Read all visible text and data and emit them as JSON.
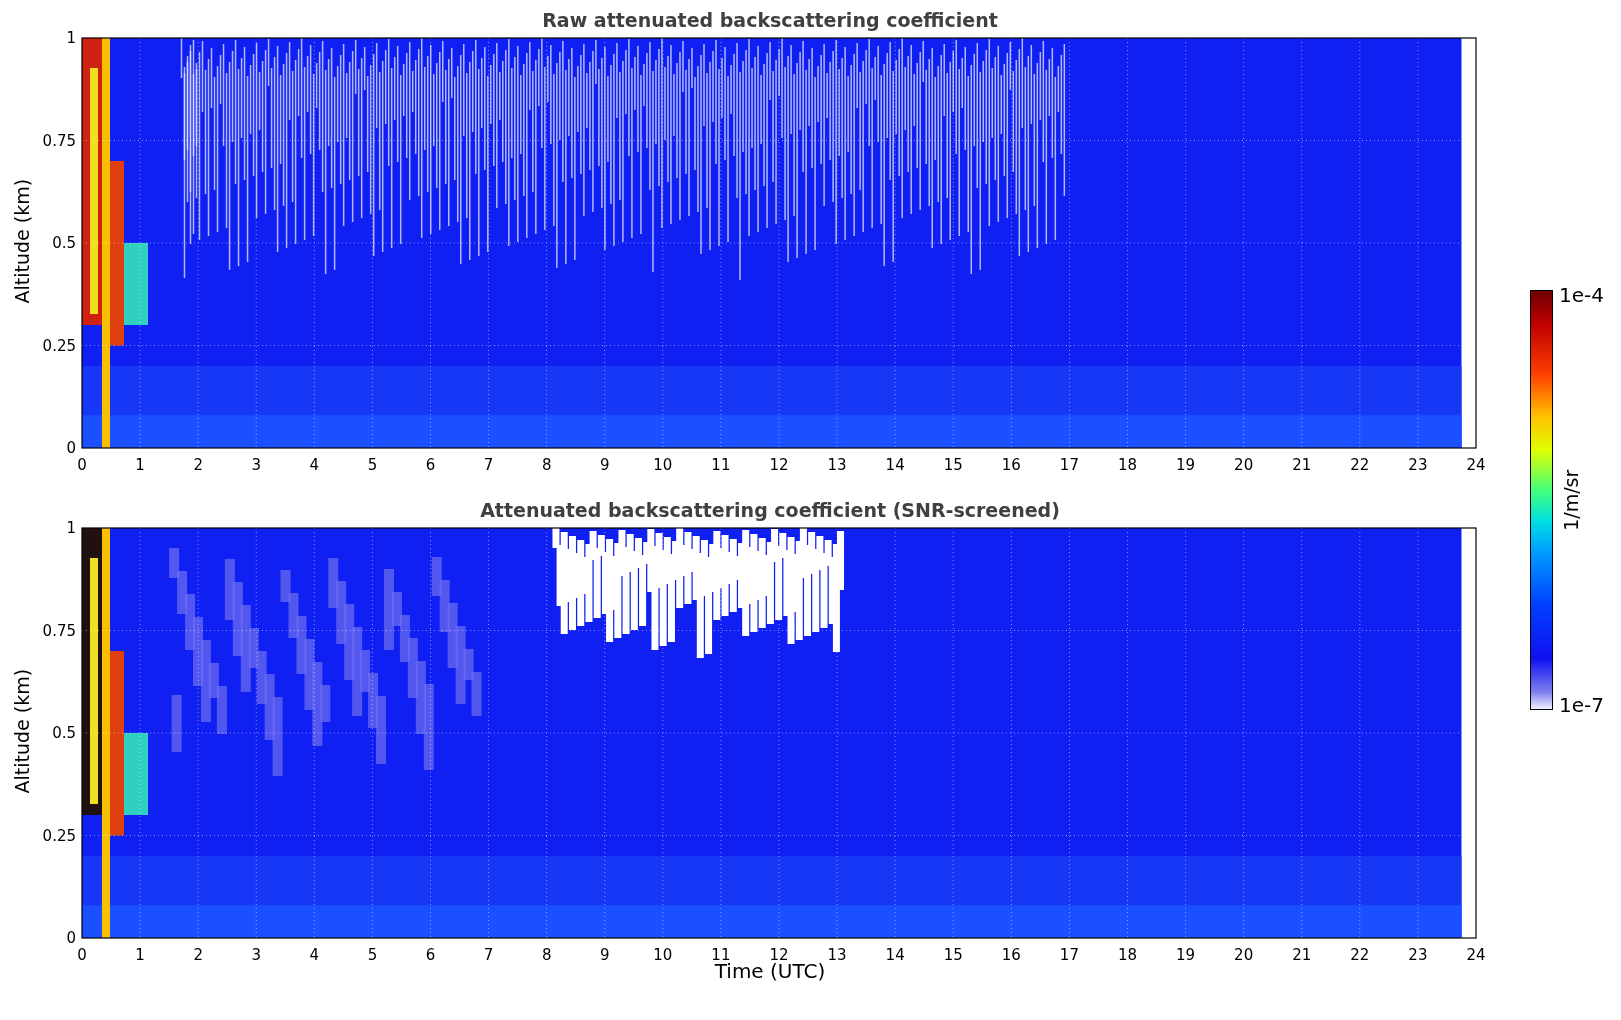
{
  "panels": [
    {
      "kind": "raw",
      "title": "Raw attenuated backscattering coefficient",
      "ylabel": "Altitude (km)",
      "y_ticks": [
        "1",
        "0.75",
        "0.5",
        "0.25",
        "0"
      ],
      "x_ticks": [
        "0",
        "1",
        "2",
        "3",
        "4",
        "5",
        "6",
        "7",
        "8",
        "9",
        "10",
        "11",
        "12",
        "13",
        "14",
        "15",
        "16",
        "17",
        "18",
        "19",
        "20",
        "21",
        "22",
        "23",
        "24"
      ]
    },
    {
      "kind": "screened",
      "title": "Attenuated backscattering coefficient (SNR-screened)",
      "ylabel": "Altitude (km)",
      "y_ticks": [
        "1",
        "0.75",
        "0.5",
        "0.25",
        "0"
      ],
      "x_ticks": [
        "0",
        "1",
        "2",
        "3",
        "4",
        "5",
        "6",
        "7",
        "8",
        "9",
        "10",
        "11",
        "12",
        "13",
        "14",
        "15",
        "16",
        "17",
        "18",
        "19",
        "20",
        "21",
        "22",
        "23",
        "24"
      ],
      "xlabel": "Time (UTC)"
    }
  ],
  "colorbar": {
    "max_label": "1e-4",
    "min_label": "1e-7",
    "unit": "1/m/sr"
  }
}
